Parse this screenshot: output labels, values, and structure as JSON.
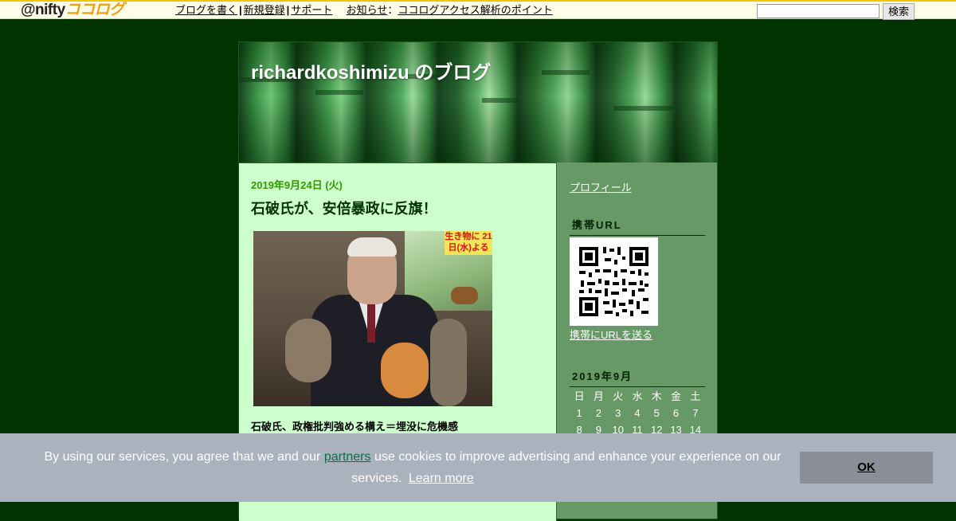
{
  "topbar": {
    "logo_prefix": "@nifty",
    "logo_suffix": "ココログ",
    "nav": [
      "ブログを書く",
      "新規登録",
      "サポート"
    ],
    "news_label": "お知らせ",
    "news_colon": "：",
    "news_link": "ココログアクセス解析のポイント",
    "search_button": "検索",
    "search_value": ""
  },
  "blog": {
    "title": "richardkoshimizu のブログ"
  },
  "post": {
    "date": "2019年9月24日 (火)",
    "title": "石破氏が、安倍暴政に反旗！",
    "photo_sign": "生き物に 21日(水)よる",
    "subtitle": "石破氏、政権批判強める構え＝埋没に危機感"
  },
  "sidebar": {
    "profile_link": "プロフィール",
    "mobile_heading": "携帯URL",
    "mobile_link": "携帯にURLを送る",
    "calendar_heading": "2019年9月",
    "weekdays": [
      "日",
      "月",
      "火",
      "水",
      "木",
      "金",
      "土"
    ],
    "weeks": [
      [
        "1",
        "2",
        "3",
        "4",
        "5",
        "6",
        "7"
      ],
      [
        "8",
        "9",
        "10",
        "11",
        "12",
        "13",
        "14"
      ]
    ]
  },
  "cookie": {
    "text_before": "By using our services, you agree that we and our",
    "partners_link": "partners",
    "text_after": "use cookies to improve advertising and enhance your experience on our services.",
    "learn_more": "Learn more",
    "ok_button": "OK"
  },
  "colors": {
    "page_bg": "#003300",
    "sidebar_bg": "#669966",
    "main_bg": "#ccffcc",
    "date_green": "#339900",
    "cookie_bg": "#aab2bd",
    "ok_bg": "#8a8e97",
    "partners_link": "#0a6e47"
  }
}
